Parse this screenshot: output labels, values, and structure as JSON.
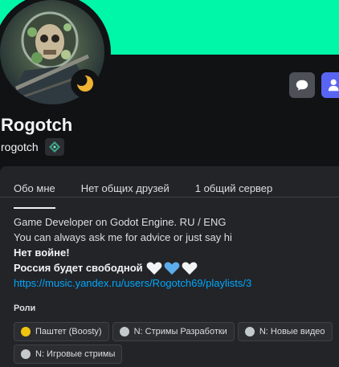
{
  "colors": {
    "banner": "#00f7a8",
    "boost_role": "#f1c40f",
    "default_role": "#c4c9ce",
    "link": "#00a8fc",
    "primary_button": "#5865f2"
  },
  "profile": {
    "display_name": "Rogotch",
    "username": "rogotch",
    "status_icon": "moon-idle-icon",
    "badge_icon": "hypesquad-badge-icon"
  },
  "actions": {
    "message_icon": "chat-bubble-icon",
    "add_friend_icon": "add-friend-icon"
  },
  "tabs": [
    {
      "label": "Обо мне",
      "active": true
    },
    {
      "label": "Нет общих друзей",
      "active": false
    },
    {
      "label": "1 общий сервер",
      "active": false
    }
  ],
  "bio": {
    "line1": "Game Developer on Godot Engine. RU / ENG",
    "line2": "You can always ask me for advice or just say hi",
    "line3": "Нет войне!",
    "line4": "Россия будет свободной",
    "link": "https://music.yandex.ru/users/Rogotch69/playlists/3"
  },
  "roles": {
    "title": "Роли",
    "items": [
      {
        "label": "Паштет (Boosty)",
        "color": "#f1c40f"
      },
      {
        "label": "N: Стримы Разработки",
        "color": "#c4c9ce"
      },
      {
        "label": "N: Новые видео",
        "color": "#c4c9ce"
      },
      {
        "label": "N: Игровые стримы",
        "color": "#c4c9ce"
      }
    ]
  }
}
